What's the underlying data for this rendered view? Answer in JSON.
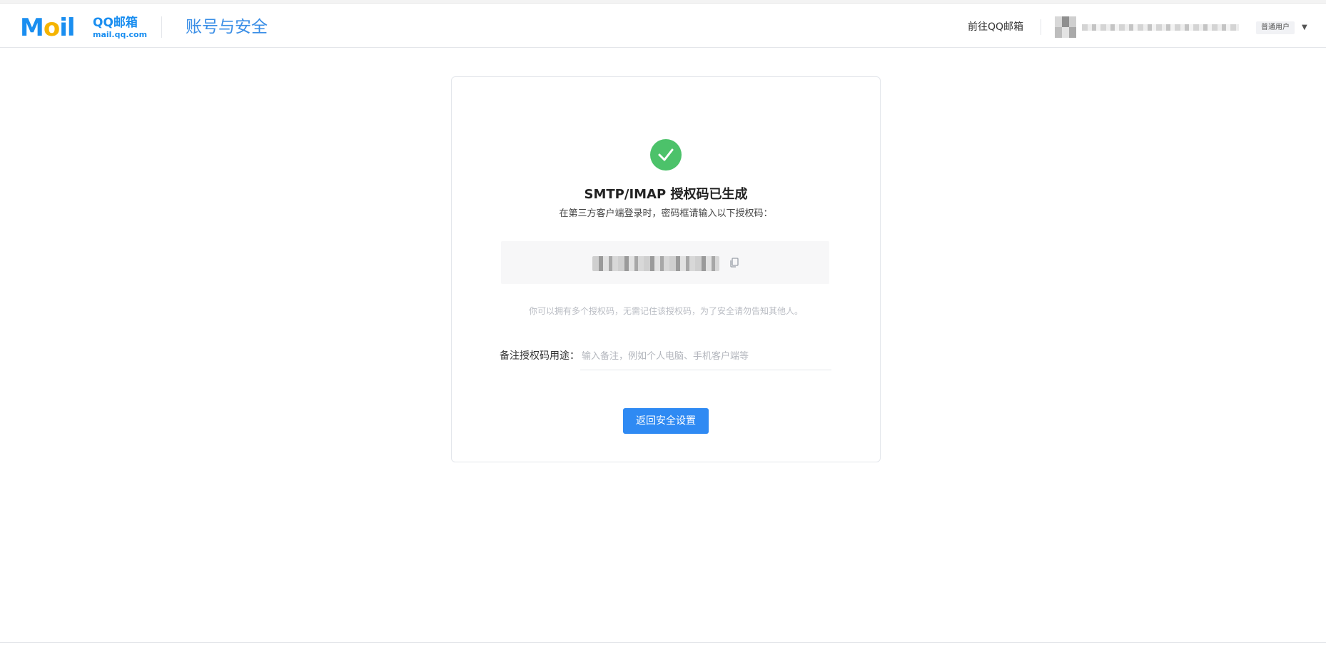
{
  "header": {
    "logo_mail": "Mail",
    "logo_qq": "QQ邮箱",
    "logo_domain": "mail.qq.com",
    "title": "账号与安全",
    "goto_mailbox": "前往QQ邮箱",
    "user_badge": "普通用户",
    "caret_icon": "caret-down-icon"
  },
  "card": {
    "status_icon": "check-circle-icon",
    "title": "SMTP/IMAP 授权码已生成",
    "subtitle": "在第三方客户端登录时，密码框请输入以下授权码：",
    "copy_icon": "copy-icon",
    "hint": "你可以拥有多个授权码，无需记住该授权码，为了安全请勿告知其他人。",
    "remark_label": "备注授权码用途：",
    "remark_value": "",
    "remark_placeholder": "输入备注，例如个人电脑、手机客户端等",
    "back_button": "返回安全设置"
  },
  "colors": {
    "brand_blue": "#1a8ef0",
    "primary_button": "#2f8af3",
    "success_green": "#4cc26a"
  }
}
